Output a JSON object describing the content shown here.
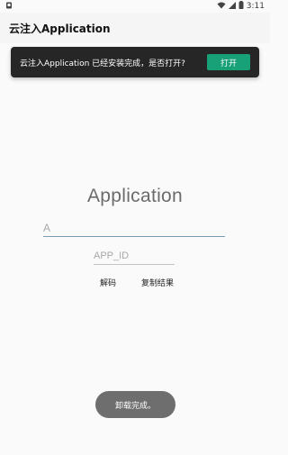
{
  "status_bar": {
    "time": "3:11",
    "left_icon": "sim-card-icon",
    "icons": [
      "wifi-icon",
      "signal-icon",
      "battery-icon"
    ]
  },
  "app_bar": {
    "title": "云注入Application"
  },
  "snackbar": {
    "message": "云注入Application 已经安装完成，是否打开?",
    "action_label": "打开",
    "action_color": "#18a077"
  },
  "main": {
    "title": "Application",
    "package_input": {
      "placeholder": "A",
      "value": ""
    },
    "app_id_input": {
      "placeholder": "APP_ID",
      "value": ""
    },
    "decode_label": "解码",
    "copy_label": "复制结果"
  },
  "toast": {
    "message": "卸载完成。"
  },
  "colors": {
    "background": "#fafafa",
    "snackbar_bg": "#262626",
    "accent": "#18a077",
    "input_underline": "#7a9bb4",
    "toast_bg": "#6e6e6e"
  }
}
